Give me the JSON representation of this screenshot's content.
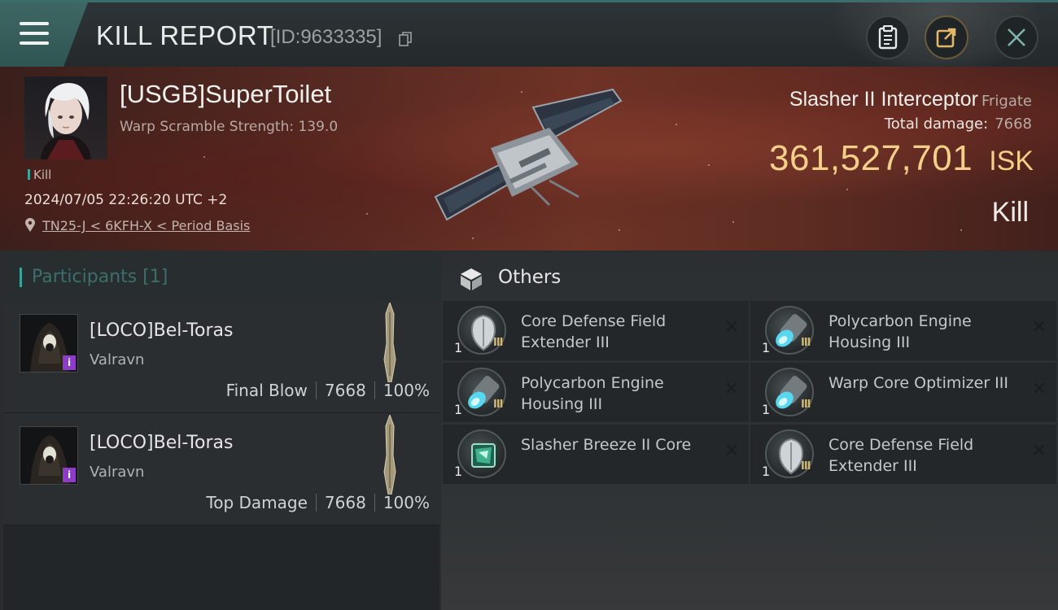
{
  "header": {
    "title": "KILL REPORT",
    "id_text": "[ID:9633335]"
  },
  "victim": {
    "name": "[USGB]SuperToilet",
    "warp_strength": "Warp Scramble Strength: 139.0",
    "badge": "Kill",
    "timestamp": "2024/07/05 22:26:20 UTC +2",
    "location": "TN25-J < 6KFH-X < Period Basis"
  },
  "ship": {
    "name": "Slasher II Interceptor",
    "class": "Frigate",
    "total_damage_label": "Total damage:",
    "total_damage": "7668",
    "isk_value": "361,527,701",
    "isk_unit": "ISK",
    "result": "Kill"
  },
  "participants": {
    "title": "Participants [1]",
    "items": [
      {
        "name": "[LOCO]Bel-Toras",
        "ship": "Valravn",
        "role": "Final Blow",
        "damage": "7668",
        "percent": "100%",
        "tag": "i"
      },
      {
        "name": "[LOCO]Bel-Toras",
        "ship": "Valravn",
        "role": "Top Damage",
        "damage": "7668",
        "percent": "100%",
        "tag": "i"
      }
    ]
  },
  "others": {
    "title": "Others",
    "items": [
      {
        "name": "Core Defense Field Extender III",
        "qty": "1",
        "icon": "shield-extender-icon",
        "meta": "III"
      },
      {
        "name": "Polycarbon Engine Housing III",
        "qty": "1",
        "icon": "engine-housing-icon",
        "meta": "III"
      },
      {
        "name": "Polycarbon Engine Housing III",
        "qty": "1",
        "icon": "engine-housing-icon",
        "meta": "III"
      },
      {
        "name": "Warp Core Optimizer III",
        "qty": "1",
        "icon": "warp-core-icon",
        "meta": "III"
      },
      {
        "name": "Slasher Breeze II Core",
        "qty": "1",
        "icon": "breeze-core-icon",
        "meta": ""
      },
      {
        "name": "Core Defense Field Extender III",
        "qty": "1",
        "icon": "shield-extender-icon",
        "meta": "III"
      }
    ]
  },
  "colors": {
    "accent": "#3ba39a",
    "isk": "#f3cf8a",
    "tag": "#8d3cc9"
  }
}
